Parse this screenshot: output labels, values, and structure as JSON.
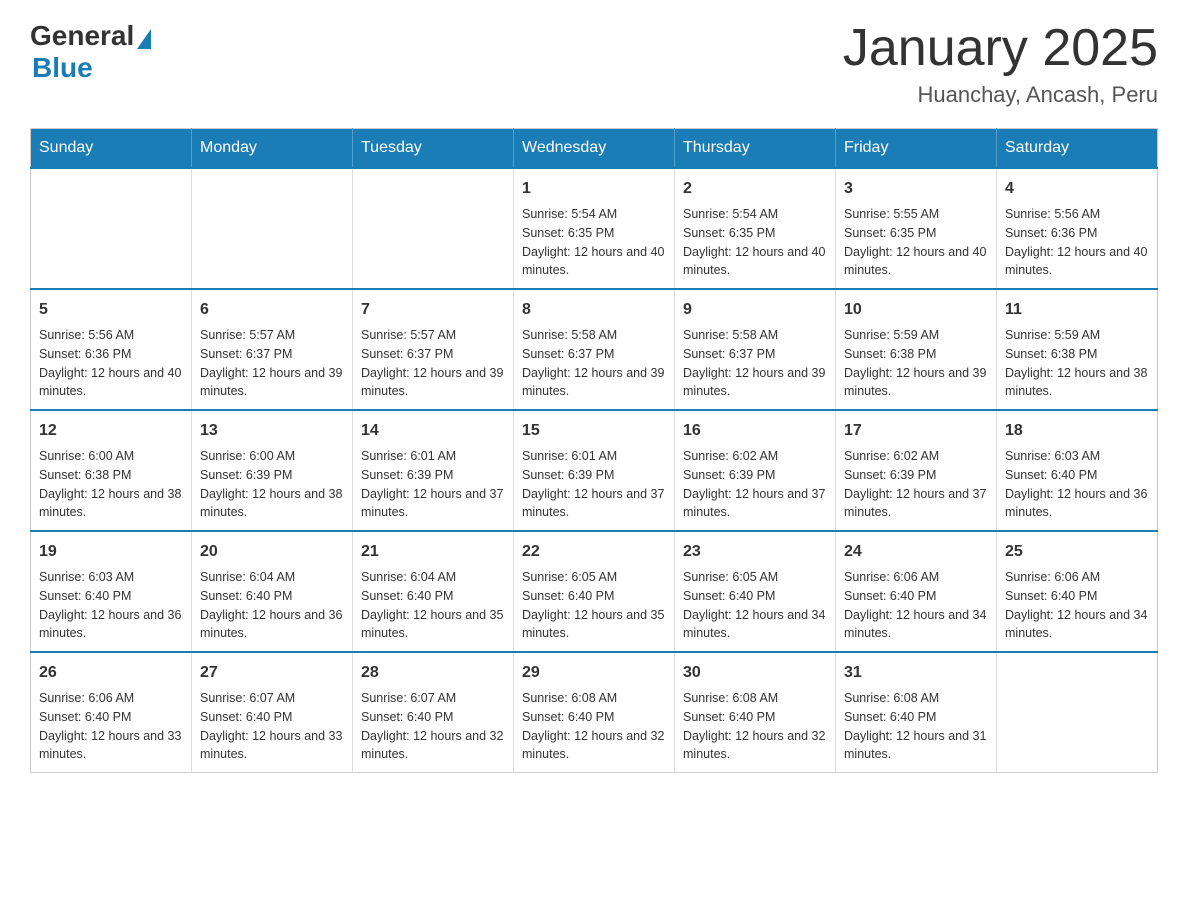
{
  "logo": {
    "general": "General",
    "blue": "Blue"
  },
  "header": {
    "title": "January 2025",
    "location": "Huanchay, Ancash, Peru"
  },
  "days_of_week": [
    "Sunday",
    "Monday",
    "Tuesday",
    "Wednesday",
    "Thursday",
    "Friday",
    "Saturday"
  ],
  "weeks": [
    [
      {
        "day": "",
        "info": ""
      },
      {
        "day": "",
        "info": ""
      },
      {
        "day": "",
        "info": ""
      },
      {
        "day": "1",
        "info": "Sunrise: 5:54 AM\nSunset: 6:35 PM\nDaylight: 12 hours and 40 minutes."
      },
      {
        "day": "2",
        "info": "Sunrise: 5:54 AM\nSunset: 6:35 PM\nDaylight: 12 hours and 40 minutes."
      },
      {
        "day": "3",
        "info": "Sunrise: 5:55 AM\nSunset: 6:35 PM\nDaylight: 12 hours and 40 minutes."
      },
      {
        "day": "4",
        "info": "Sunrise: 5:56 AM\nSunset: 6:36 PM\nDaylight: 12 hours and 40 minutes."
      }
    ],
    [
      {
        "day": "5",
        "info": "Sunrise: 5:56 AM\nSunset: 6:36 PM\nDaylight: 12 hours and 40 minutes."
      },
      {
        "day": "6",
        "info": "Sunrise: 5:57 AM\nSunset: 6:37 PM\nDaylight: 12 hours and 39 minutes."
      },
      {
        "day": "7",
        "info": "Sunrise: 5:57 AM\nSunset: 6:37 PM\nDaylight: 12 hours and 39 minutes."
      },
      {
        "day": "8",
        "info": "Sunrise: 5:58 AM\nSunset: 6:37 PM\nDaylight: 12 hours and 39 minutes."
      },
      {
        "day": "9",
        "info": "Sunrise: 5:58 AM\nSunset: 6:37 PM\nDaylight: 12 hours and 39 minutes."
      },
      {
        "day": "10",
        "info": "Sunrise: 5:59 AM\nSunset: 6:38 PM\nDaylight: 12 hours and 39 minutes."
      },
      {
        "day": "11",
        "info": "Sunrise: 5:59 AM\nSunset: 6:38 PM\nDaylight: 12 hours and 38 minutes."
      }
    ],
    [
      {
        "day": "12",
        "info": "Sunrise: 6:00 AM\nSunset: 6:38 PM\nDaylight: 12 hours and 38 minutes."
      },
      {
        "day": "13",
        "info": "Sunrise: 6:00 AM\nSunset: 6:39 PM\nDaylight: 12 hours and 38 minutes."
      },
      {
        "day": "14",
        "info": "Sunrise: 6:01 AM\nSunset: 6:39 PM\nDaylight: 12 hours and 37 minutes."
      },
      {
        "day": "15",
        "info": "Sunrise: 6:01 AM\nSunset: 6:39 PM\nDaylight: 12 hours and 37 minutes."
      },
      {
        "day": "16",
        "info": "Sunrise: 6:02 AM\nSunset: 6:39 PM\nDaylight: 12 hours and 37 minutes."
      },
      {
        "day": "17",
        "info": "Sunrise: 6:02 AM\nSunset: 6:39 PM\nDaylight: 12 hours and 37 minutes."
      },
      {
        "day": "18",
        "info": "Sunrise: 6:03 AM\nSunset: 6:40 PM\nDaylight: 12 hours and 36 minutes."
      }
    ],
    [
      {
        "day": "19",
        "info": "Sunrise: 6:03 AM\nSunset: 6:40 PM\nDaylight: 12 hours and 36 minutes."
      },
      {
        "day": "20",
        "info": "Sunrise: 6:04 AM\nSunset: 6:40 PM\nDaylight: 12 hours and 36 minutes."
      },
      {
        "day": "21",
        "info": "Sunrise: 6:04 AM\nSunset: 6:40 PM\nDaylight: 12 hours and 35 minutes."
      },
      {
        "day": "22",
        "info": "Sunrise: 6:05 AM\nSunset: 6:40 PM\nDaylight: 12 hours and 35 minutes."
      },
      {
        "day": "23",
        "info": "Sunrise: 6:05 AM\nSunset: 6:40 PM\nDaylight: 12 hours and 34 minutes."
      },
      {
        "day": "24",
        "info": "Sunrise: 6:06 AM\nSunset: 6:40 PM\nDaylight: 12 hours and 34 minutes."
      },
      {
        "day": "25",
        "info": "Sunrise: 6:06 AM\nSunset: 6:40 PM\nDaylight: 12 hours and 34 minutes."
      }
    ],
    [
      {
        "day": "26",
        "info": "Sunrise: 6:06 AM\nSunset: 6:40 PM\nDaylight: 12 hours and 33 minutes."
      },
      {
        "day": "27",
        "info": "Sunrise: 6:07 AM\nSunset: 6:40 PM\nDaylight: 12 hours and 33 minutes."
      },
      {
        "day": "28",
        "info": "Sunrise: 6:07 AM\nSunset: 6:40 PM\nDaylight: 12 hours and 32 minutes."
      },
      {
        "day": "29",
        "info": "Sunrise: 6:08 AM\nSunset: 6:40 PM\nDaylight: 12 hours and 32 minutes."
      },
      {
        "day": "30",
        "info": "Sunrise: 6:08 AM\nSunset: 6:40 PM\nDaylight: 12 hours and 32 minutes."
      },
      {
        "day": "31",
        "info": "Sunrise: 6:08 AM\nSunset: 6:40 PM\nDaylight: 12 hours and 31 minutes."
      },
      {
        "day": "",
        "info": ""
      }
    ]
  ]
}
